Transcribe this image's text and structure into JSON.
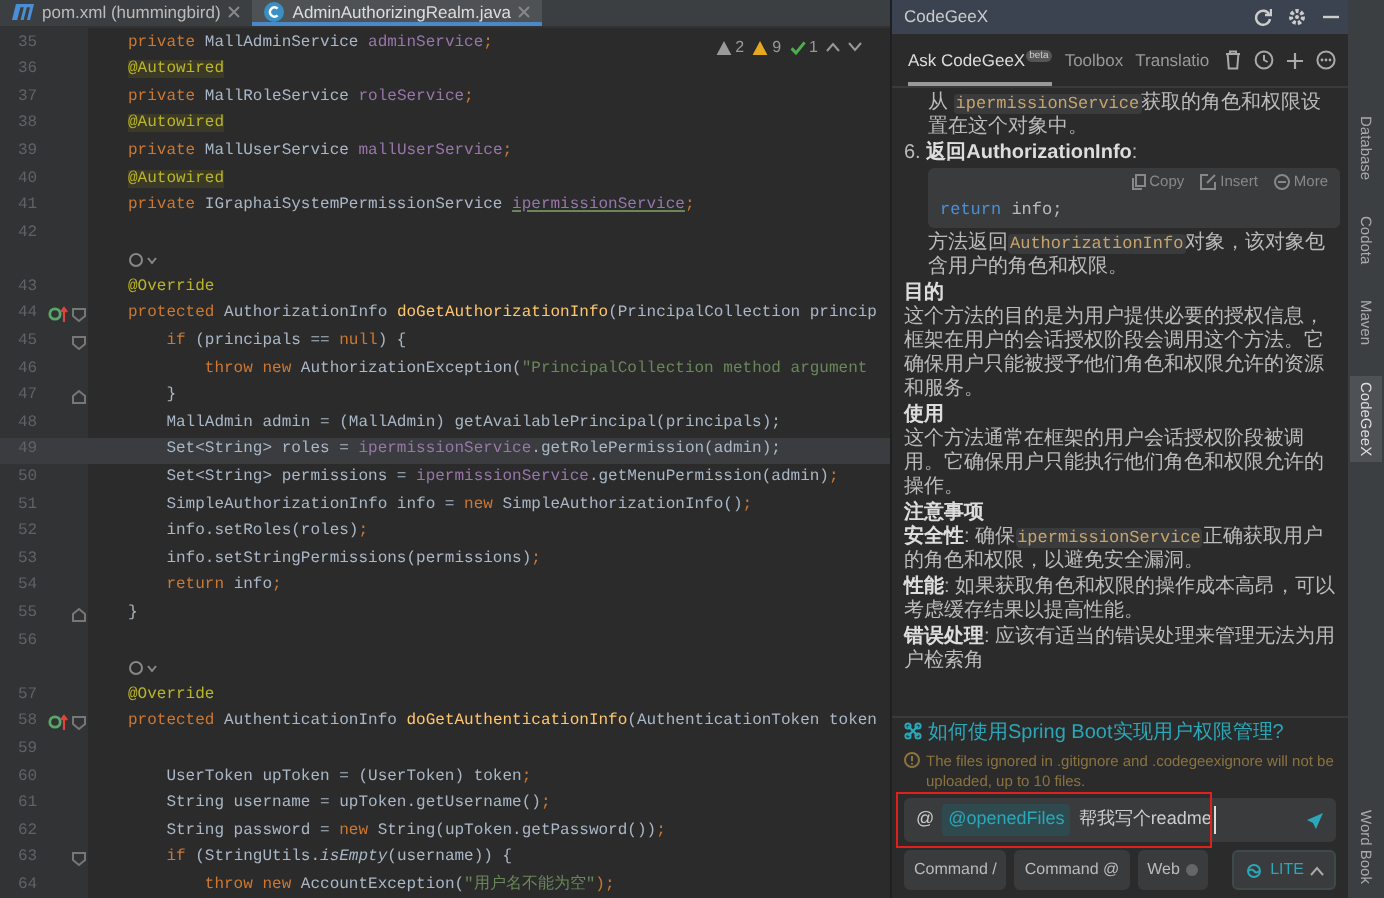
{
  "editor": {
    "tabs": [
      {
        "label": "pom.xml (hummingbird)",
        "kind": "maven",
        "selected": false
      },
      {
        "label": "AdminAuthorizingRealm.java",
        "kind": "class",
        "selected": true
      }
    ],
    "inspections": [
      {
        "kind": "weak-warning",
        "count": "2"
      },
      {
        "kind": "warning",
        "count": "9"
      },
      {
        "kind": "ok",
        "count": "1"
      }
    ],
    "lines": [
      {
        "kind": "code",
        "number": "35",
        "current": false,
        "tokens": [
          {
            "text": "private",
            "kind": "kw"
          },
          {
            "text": " MallAdminService ",
            "kind": "p"
          },
          {
            "text": "adminService",
            "kind": "f"
          },
          {
            "text": ";",
            "kind": "kw"
          }
        ]
      },
      {
        "kind": "code",
        "number": "36",
        "current": false,
        "tokens": [
          {
            "text": "@Autowired",
            "kind": "an"
          }
        ]
      },
      {
        "kind": "code",
        "number": "37",
        "current": false,
        "tokens": [
          {
            "text": "private",
            "kind": "kw"
          },
          {
            "text": " MallRoleService ",
            "kind": "p"
          },
          {
            "text": "roleService",
            "kind": "f"
          },
          {
            "text": ";",
            "kind": "kw"
          }
        ]
      },
      {
        "kind": "code",
        "number": "38",
        "current": false,
        "tokens": [
          {
            "text": "@Autowired",
            "kind": "an"
          }
        ]
      },
      {
        "kind": "code",
        "number": "39",
        "current": false,
        "tokens": [
          {
            "text": "private",
            "kind": "kw"
          },
          {
            "text": " MallUserService ",
            "kind": "p"
          },
          {
            "text": "mallUserService",
            "kind": "f"
          },
          {
            "text": ";",
            "kind": "kw"
          }
        ]
      },
      {
        "kind": "code",
        "number": "40",
        "current": false,
        "tokens": [
          {
            "text": "@Autowired",
            "kind": "an"
          }
        ]
      },
      {
        "kind": "code",
        "number": "41",
        "current": false,
        "tokens": [
          {
            "text": "private",
            "kind": "kw"
          },
          {
            "text": " IGraphaiSystemPermissionService ",
            "kind": "p"
          },
          {
            "text": "ipermissionService",
            "kind": "fu"
          },
          {
            "text": ";",
            "kind": "kw"
          }
        ]
      },
      {
        "kind": "code",
        "number": "42",
        "current": false
      },
      {
        "kind": "hint"
      },
      {
        "kind": "code",
        "number": "43",
        "current": false,
        "tokens": [
          {
            "text": "@Override",
            "kind": "an2"
          }
        ]
      },
      {
        "kind": "code",
        "number": "44",
        "current": false,
        "gutter": [
          {
            "kind": "override"
          },
          {
            "kind": "fold-start"
          }
        ],
        "tokens": [
          {
            "text": "protected",
            "kind": "kw"
          },
          {
            "text": " AuthorizationInfo ",
            "kind": "p"
          },
          {
            "text": "doGetAuthorizationInfo",
            "kind": "m"
          },
          {
            "text": "(PrincipalCollection princip",
            "kind": "p"
          }
        ]
      },
      {
        "kind": "code",
        "number": "45",
        "current": false,
        "gutter": [
          {
            "kind": "fold-start"
          }
        ],
        "tokens": [
          {
            "text": "    if",
            "kind": "kw"
          },
          {
            "text": " (principals == ",
            "kind": "p"
          },
          {
            "text": "null",
            "kind": "kw"
          },
          {
            "text": ") {",
            "kind": "p"
          }
        ]
      },
      {
        "kind": "code",
        "number": "46",
        "current": false,
        "tokens": [
          {
            "text": "        throw new",
            "kind": "kw"
          },
          {
            "text": " AuthorizationException(",
            "kind": "p"
          },
          {
            "text": "\"PrincipalCollection method argument",
            "kind": "s"
          }
        ]
      },
      {
        "kind": "code",
        "number": "47",
        "current": false,
        "gutter": [
          {
            "kind": "fold-end"
          }
        ],
        "tokens": [
          {
            "text": "    }",
            "kind": "p"
          }
        ]
      },
      {
        "kind": "code",
        "number": "48",
        "current": false,
        "tokens": [
          {
            "text": "    MallAdmin admin = (MallAdmin) getAvailablePrincipal(principals);",
            "kind": "p"
          }
        ]
      },
      {
        "kind": "code",
        "number": "49",
        "current": true,
        "tokens": [
          {
            "text": "    Set<String> roles = ",
            "kind": "p"
          },
          {
            "text": "ipermissionService",
            "kind": "f"
          },
          {
            "text": ".getRolePermission(admin);",
            "kind": "p"
          }
        ]
      },
      {
        "kind": "code",
        "number": "50",
        "current": false,
        "tokens": [
          {
            "text": "    Set<String> permissions = ",
            "kind": "p"
          },
          {
            "text": "ipermissionService",
            "kind": "f"
          },
          {
            "text": ".getMenuPermission(admin)",
            "kind": "p"
          },
          {
            "text": ";",
            "kind": "kw"
          }
        ]
      },
      {
        "kind": "code",
        "number": "51",
        "current": false,
        "tokens": [
          {
            "text": "    SimpleAuthorizationInfo info = ",
            "kind": "p"
          },
          {
            "text": "new",
            "kind": "kw"
          },
          {
            "text": " SimpleAuthorizationInfo()",
            "kind": "p"
          },
          {
            "text": ";",
            "kind": "kw"
          }
        ]
      },
      {
        "kind": "code",
        "number": "52",
        "current": false,
        "tokens": [
          {
            "text": "    info.setRoles(roles)",
            "kind": "p"
          },
          {
            "text": ";",
            "kind": "kw"
          }
        ]
      },
      {
        "kind": "code",
        "number": "53",
        "current": false,
        "tokens": [
          {
            "text": "    info.setStringPermissions(permissions)",
            "kind": "p"
          },
          {
            "text": ";",
            "kind": "kw"
          }
        ]
      },
      {
        "kind": "code",
        "number": "54",
        "current": false,
        "tokens": [
          {
            "text": "    return",
            "kind": "kw"
          },
          {
            "text": " info",
            "kind": "p"
          },
          {
            "text": ";",
            "kind": "kw"
          }
        ]
      },
      {
        "kind": "code",
        "number": "55",
        "current": false,
        "gutter": [
          {
            "kind": "fold-end"
          }
        ],
        "tokens": [
          {
            "text": "}",
            "kind": "p"
          }
        ]
      },
      {
        "kind": "code",
        "number": "56",
        "current": false
      },
      {
        "kind": "hint"
      },
      {
        "kind": "code",
        "number": "57",
        "current": false,
        "tokens": [
          {
            "text": "@Override",
            "kind": "an2"
          }
        ]
      },
      {
        "kind": "code",
        "number": "58",
        "current": false,
        "gutter": [
          {
            "kind": "override"
          },
          {
            "kind": "fold-start"
          }
        ],
        "tokens": [
          {
            "text": "protected",
            "kind": "kw"
          },
          {
            "text": " AuthenticationInfo ",
            "kind": "p"
          },
          {
            "text": "doGetAuthenticationInfo",
            "kind": "m"
          },
          {
            "text": "(AuthenticationToken token",
            "kind": "p"
          }
        ]
      },
      {
        "kind": "code",
        "number": "59",
        "current": false
      },
      {
        "kind": "code",
        "number": "60",
        "current": false,
        "tokens": [
          {
            "text": "    UserToken upToken = (UserToken) token",
            "kind": "p"
          },
          {
            "text": ";",
            "kind": "kw"
          }
        ]
      },
      {
        "kind": "code",
        "number": "61",
        "current": false,
        "tokens": [
          {
            "text": "    String username = upToken.getUsername()",
            "kind": "p"
          },
          {
            "text": ";",
            "kind": "kw"
          }
        ]
      },
      {
        "kind": "code",
        "number": "62",
        "current": false,
        "tokens": [
          {
            "text": "    String password = ",
            "kind": "p"
          },
          {
            "text": "new",
            "kind": "kw"
          },
          {
            "text": " String(upToken.getPassword())",
            "kind": "p"
          },
          {
            "text": ";",
            "kind": "kw"
          }
        ]
      },
      {
        "kind": "code",
        "number": "63",
        "current": false,
        "gutter": [
          {
            "kind": "fold-start"
          }
        ],
        "tokens": [
          {
            "text": "    if",
            "kind": "kw"
          },
          {
            "text": " (StringUtils.",
            "kind": "p"
          },
          {
            "text": "isEmpty",
            "kind": "it"
          },
          {
            "text": "(username)) {",
            "kind": "p"
          }
        ]
      },
      {
        "kind": "code",
        "number": "64",
        "current": false,
        "tokens": [
          {
            "text": "        throw new",
            "kind": "kw"
          },
          {
            "text": " AccountException(",
            "kind": "p"
          },
          {
            "text": "\"用户名不能为空\"",
            "kind": "s"
          },
          {
            "text": ");",
            "kind": "kw"
          }
        ]
      }
    ]
  },
  "assistant": {
    "title": "CodeGeeX",
    "tabs": [
      {
        "label": "Ask CodeGeeX",
        "badge": "beta",
        "selected": true
      },
      {
        "label": "Toolbox",
        "selected": false
      },
      {
        "label": "Translatio",
        "selected": false
      }
    ],
    "messages": [
      {
        "kind": "list-cont",
        "segments": [
          {
            "text": "从 ",
            "kind": "t"
          },
          {
            "text": "ipermissionService",
            "kind": "c"
          },
          {
            "text": "获取的角色和权限设置在这个对象中。",
            "kind": "t"
          }
        ]
      },
      {
        "kind": "list-item",
        "segments": [
          {
            "text": "6. ",
            "kind": "t"
          },
          {
            "text": "返回AuthorizationInfo",
            "kind": "b"
          },
          {
            "text": ":",
            "kind": "t"
          }
        ]
      },
      {
        "kind": "code",
        "actions": [
          {
            "label": "Copy",
            "kind": "copy"
          },
          {
            "label": "Insert",
            "kind": "insert"
          },
          {
            "label": "More",
            "kind": "more"
          }
        ],
        "tokens": [
          {
            "text": "return",
            "kind": "kw"
          },
          {
            "text": " info;",
            "kind": "p"
          }
        ]
      },
      {
        "kind": "list-cont",
        "segments": [
          {
            "text": "方法返回",
            "kind": "t"
          },
          {
            "text": "AuthorizationInfo",
            "kind": "c"
          },
          {
            "text": "对象，该对象包含用户的角色和权限。",
            "kind": "t"
          }
        ]
      },
      {
        "kind": "heading",
        "text": "目的"
      },
      {
        "kind": "para",
        "segments": [
          {
            "text": "这个方法的目的是为用户提供必要的授权信息，框架在用户的会话授权阶段会调用这个方法。它确保用户只能被授予他们角色和权限允许的资源和服务。",
            "kind": "t"
          }
        ]
      },
      {
        "kind": "heading",
        "text": "使用"
      },
      {
        "kind": "para",
        "segments": [
          {
            "text": "这个方法通常在框架的用户会话授权阶段被调用。它确保用户只能执行他们角色和权限允许的操作。",
            "kind": "t"
          }
        ]
      },
      {
        "kind": "heading",
        "text": "注意事项"
      },
      {
        "kind": "para",
        "segments": [
          {
            "text": "安全性",
            "kind": "b"
          },
          {
            "text": ": 确保",
            "kind": "t"
          },
          {
            "text": "ipermissionService",
            "kind": "c"
          },
          {
            "text": "正确获取用户的角色和权限，以避免安全漏洞。",
            "kind": "t"
          }
        ]
      },
      {
        "kind": "para",
        "segments": [
          {
            "text": "性能",
            "kind": "b"
          },
          {
            "text": ": 如果获取角色和权限的操作成本高昂，可以考虑缓存结果以提高性能。",
            "kind": "t"
          }
        ]
      },
      {
        "kind": "para",
        "segments": [
          {
            "text": "错误处理",
            "kind": "b"
          },
          {
            "text": ": 应该有适当的错误处理来管理无法为用户检索角",
            "kind": "t"
          }
        ]
      }
    ],
    "suggestion": "如何使用Spring Boot实现用户权限管理?",
    "notice": "The files ignored in .gitignore and .codegeexignore will not be uploaded, up to 10 files.",
    "input": {
      "prefix": "@",
      "file_tag": "@openedFiles",
      "value": "帮我写个readme",
      "highlighted": true
    },
    "buttons": [
      {
        "label": "Command /",
        "kind": "plain"
      },
      {
        "label": "Command @",
        "kind": "plain"
      },
      {
        "label": "Web",
        "kind": "toggle"
      },
      {
        "label": "LITE",
        "kind": "mode"
      }
    ]
  },
  "tool_strip": [
    {
      "label": "Database",
      "selected": false
    },
    {
      "label": "Codota",
      "selected": false
    },
    {
      "label": "Maven",
      "selected": false
    },
    {
      "label": "CodeGeeX",
      "selected": true
    },
    {
      "label": "Word Book",
      "selected": false
    }
  ]
}
